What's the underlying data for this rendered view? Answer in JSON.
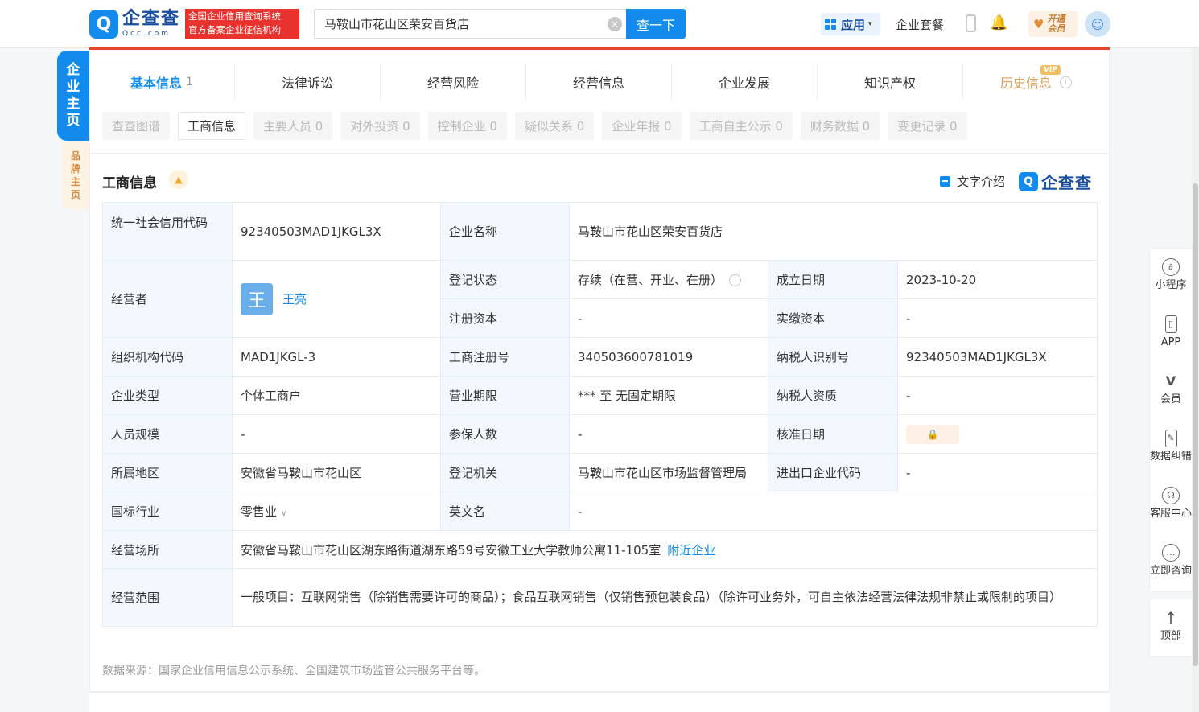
{
  "header": {
    "logo_badge": "Q",
    "logo_name": "企查查",
    "logo_sub": "Qcc.com",
    "tag_line1": "全国企业信用查询系统",
    "tag_line2": "官方备案企业征信机构",
    "search_value": "马鞍山市花山区荣安百货店",
    "clear_symbol": "×",
    "search_button": "查一下",
    "app_menu": "应用",
    "caret": "▾",
    "package_link": "企业套餐",
    "bell_symbol": "🔔",
    "vip_heart": "♥",
    "vip_open_line1": "开通",
    "vip_open_line2": "会员",
    "avatar_symbol": "☺"
  },
  "side": {
    "main_tab": [
      "企",
      "业",
      "主",
      "页"
    ],
    "brand_tab": [
      "品",
      "牌",
      "主",
      "页"
    ]
  },
  "main_tabs": [
    {
      "label": "基本信息",
      "count": "1"
    },
    {
      "label": "法律诉讼"
    },
    {
      "label": "经营风险"
    },
    {
      "label": "经营信息"
    },
    {
      "label": "企业发展"
    },
    {
      "label": "知识产权"
    },
    {
      "label": "历史信息",
      "badge": "VIP",
      "info": "i"
    }
  ],
  "sub_tabs": [
    "查查图谱",
    "工商信息",
    "主要人员 0",
    "对外投资 0",
    "控制企业 0",
    "疑似关系 0",
    "企业年报 0",
    "工商自主公示 0",
    "财务数据 0",
    "变更记录 0"
  ],
  "section": {
    "title": "工商信息",
    "bell_symbol": "▲",
    "text_intro": "文字介绍",
    "brand_badge": "Q",
    "brand_name": "企查查"
  },
  "info": {
    "credit_code_label": "统一社会信用代码",
    "credit_code": "92340503MAD1JKGL3X",
    "company_name_label": "企业名称",
    "company_name": "马鞍山市花山区荣安百货店",
    "operator_label": "经营者",
    "operator_avatar": "王",
    "operator_name": "王亮",
    "status_label": "登记状态",
    "status": "存续（在营、开业、在册）",
    "status_info": "i",
    "founded_label": "成立日期",
    "founded": "2023-10-20",
    "reg_capital_label": "注册资本",
    "reg_capital": "-",
    "paid_capital_label": "实缴资本",
    "paid_capital": "-",
    "org_code_label": "组织机构代码",
    "org_code": "MAD1JKGL-3",
    "reg_no_label": "工商注册号",
    "reg_no": "340503600781019",
    "taxpayer_id_label": "纳税人识别号",
    "taxpayer_id": "92340503MAD1JKGL3X",
    "company_type_label": "企业类型",
    "company_type": "个体工商户",
    "term_label": "营业期限",
    "term": "*** 至 无固定期限",
    "taxpayer_qual_label": "纳税人资质",
    "taxpayer_qual": "-",
    "staff_size_label": "人员规模",
    "staff_size": "-",
    "insured_label": "参保人数",
    "insured": "-",
    "approval_date_label": "核准日期",
    "approval_lock": "🔒",
    "region_label": "所属地区",
    "region": "安徽省马鞍山市花山区",
    "authority_label": "登记机关",
    "authority": "马鞍山市花山区市场监督管理局",
    "import_export_label": "进出口企业代码",
    "import_export": "-",
    "industry_label": "国标行业",
    "industry": "零售业",
    "industry_chevron": "∨",
    "english_name_label": "英文名",
    "english_name": "-",
    "address_label": "经营场所",
    "address": "安徽省马鞍山市花山区湖东路街道湖东路59号安徽工业大学教师公寓11-105室",
    "nearby_link": "附近企业",
    "scope_label": "经营范围",
    "scope": "一般项目：互联网销售（除销售需要许可的商品）；食品互联网销售（仅销售预包装食品）（除许可业务外，可自主依法经营法律法规非禁止或限制的项目）"
  },
  "footnote": "数据来源：国家企业信用信息公示系统、全国建筑市场监管公共服务平台等。",
  "float_bar": [
    {
      "icon": "∂",
      "label": "小程序"
    },
    {
      "icon": "▯",
      "label": "APP"
    },
    {
      "icon": "V",
      "label": "会员"
    },
    {
      "icon": "✎",
      "label": "数据纠错"
    },
    {
      "icon": "☊",
      "label": "客服中心"
    },
    {
      "icon": "…",
      "label": "立即咨询"
    }
  ],
  "float_top": {
    "icon": "↑",
    "label": "顶部"
  }
}
